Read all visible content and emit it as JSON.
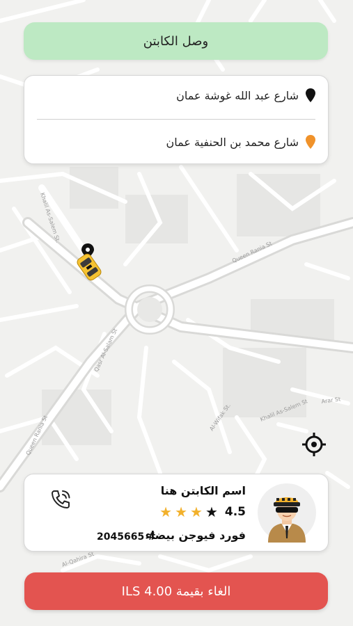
{
  "status": {
    "label": "وصل الكابتن"
  },
  "route": {
    "pickup": "شارع عبد الله غوشة عمان",
    "dropoff": "شارع محمد بن الحنفية عمان"
  },
  "map": {
    "street_labels": [
      "Khalil As-Salem St.",
      "Queen Rania St",
      "Queen Rania St",
      "Al-Wifak St.",
      "Khalil As-Salem St",
      "Qasr Al-Salam St",
      "Al-Qahira St",
      "Arar St"
    ]
  },
  "driver": {
    "name": "اسم الكابتن هنا",
    "rating": "4.5",
    "rating_value": 4.5,
    "rating_max": 5,
    "car": "فورد فيوجن بيضاء",
    "plate": "# 2045665"
  },
  "cancel": {
    "label": "الغاء بقيمة ILS 4.00"
  },
  "colors": {
    "arrived_bg": "#bde9c3",
    "cancel_bg": "#e35450",
    "star_filled": "#f2b12c",
    "star_empty": "#111111",
    "pickup_pin": "#111111",
    "dropoff_pin": "#f0922a"
  },
  "icons": {
    "pickup": "black-pin-icon",
    "dropoff": "orange-pin-icon",
    "call": "phone-call-icon",
    "locate": "crosshair-icon",
    "taxi": "taxi-car-icon"
  }
}
